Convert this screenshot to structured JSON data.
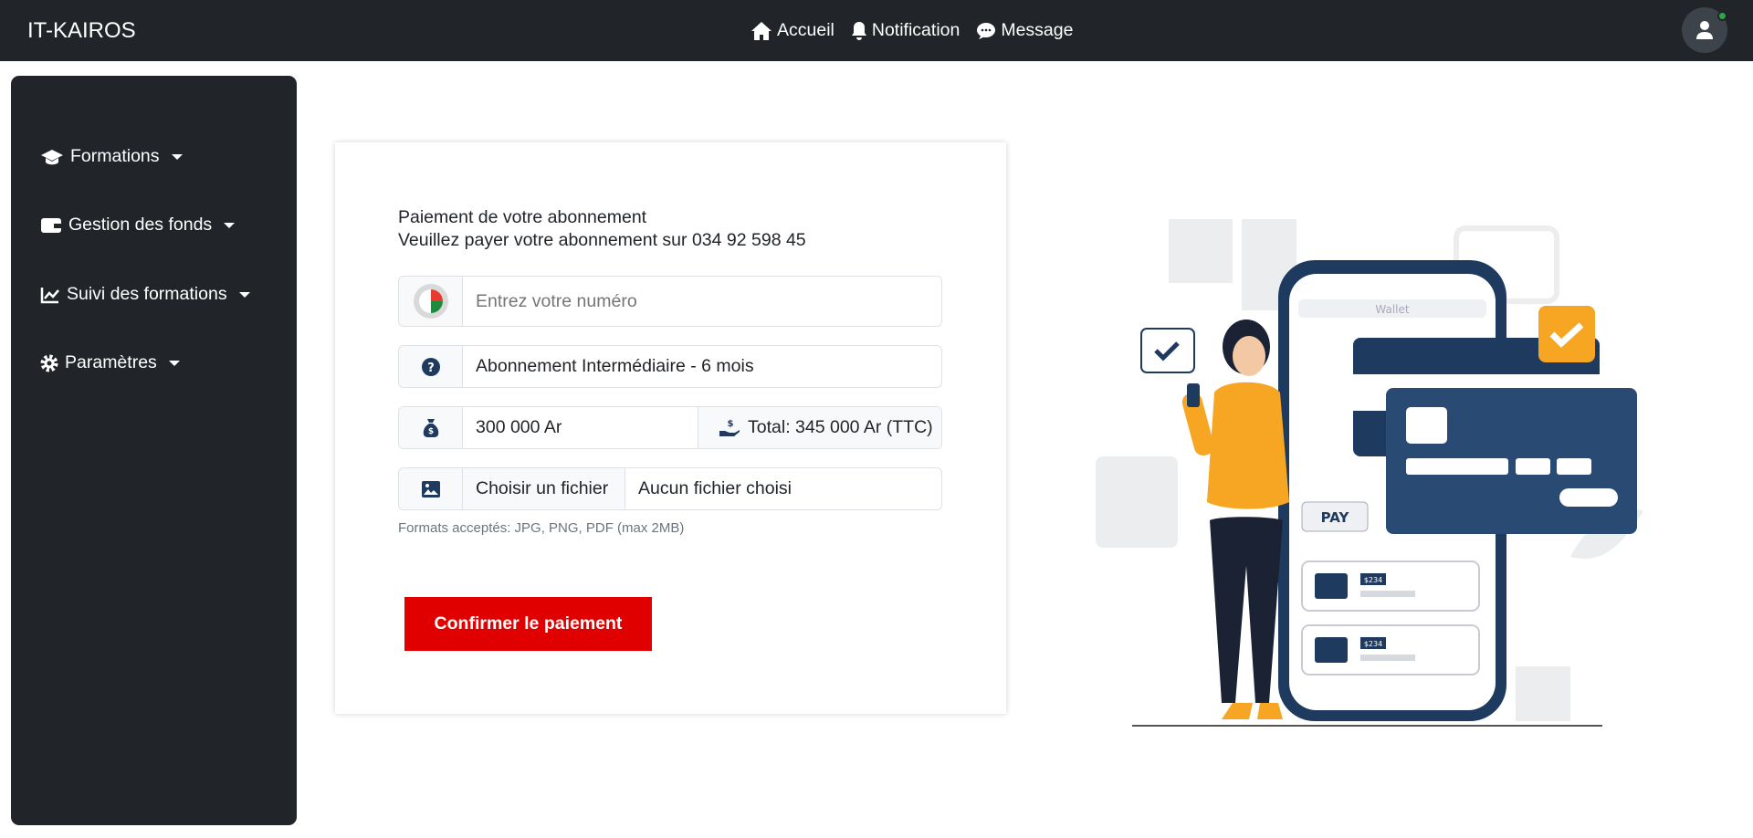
{
  "header": {
    "brand": "IT-KAIROS",
    "nav": [
      {
        "label": "Accueil",
        "icon": "home-icon"
      },
      {
        "label": "Notification",
        "icon": "bell-icon"
      },
      {
        "label": "Message",
        "icon": "comment-icon"
      }
    ]
  },
  "sidebar": {
    "items": [
      {
        "label": "Formations",
        "icon": "graduation-cap-icon"
      },
      {
        "label": "Gestion des fonds",
        "icon": "wallet-icon"
      },
      {
        "label": "Suivi des formations",
        "icon": "chart-line-icon"
      },
      {
        "label": "Paramètres",
        "icon": "gear-icon"
      }
    ]
  },
  "form": {
    "title": "Paiement de votre abonnement",
    "instruction": "Veuillez payer votre abonnement sur 034 92 598 45",
    "phone_placeholder": "Entrez votre numéro",
    "plan": "Abonnement Intermédiaire - 6 mois",
    "price": "300 000 Ar",
    "total": "Total: 345 000 Ar (TTC)",
    "file_button": "Choisir un fichier",
    "file_status": "Aucun fichier choisi",
    "help": "Formats acceptés: JPG, PNG, PDF (max 2MB)",
    "submit": "Confirmer le paiement"
  },
  "illustration": {
    "wallet_title": "Wallet",
    "pay_label": "PAY",
    "amounts": [
      "$234",
      "$234"
    ]
  },
  "colors": {
    "topbar": "#212529",
    "accent": "#e00000",
    "navy": "#1f3a5f",
    "orange": "#f6a623"
  }
}
